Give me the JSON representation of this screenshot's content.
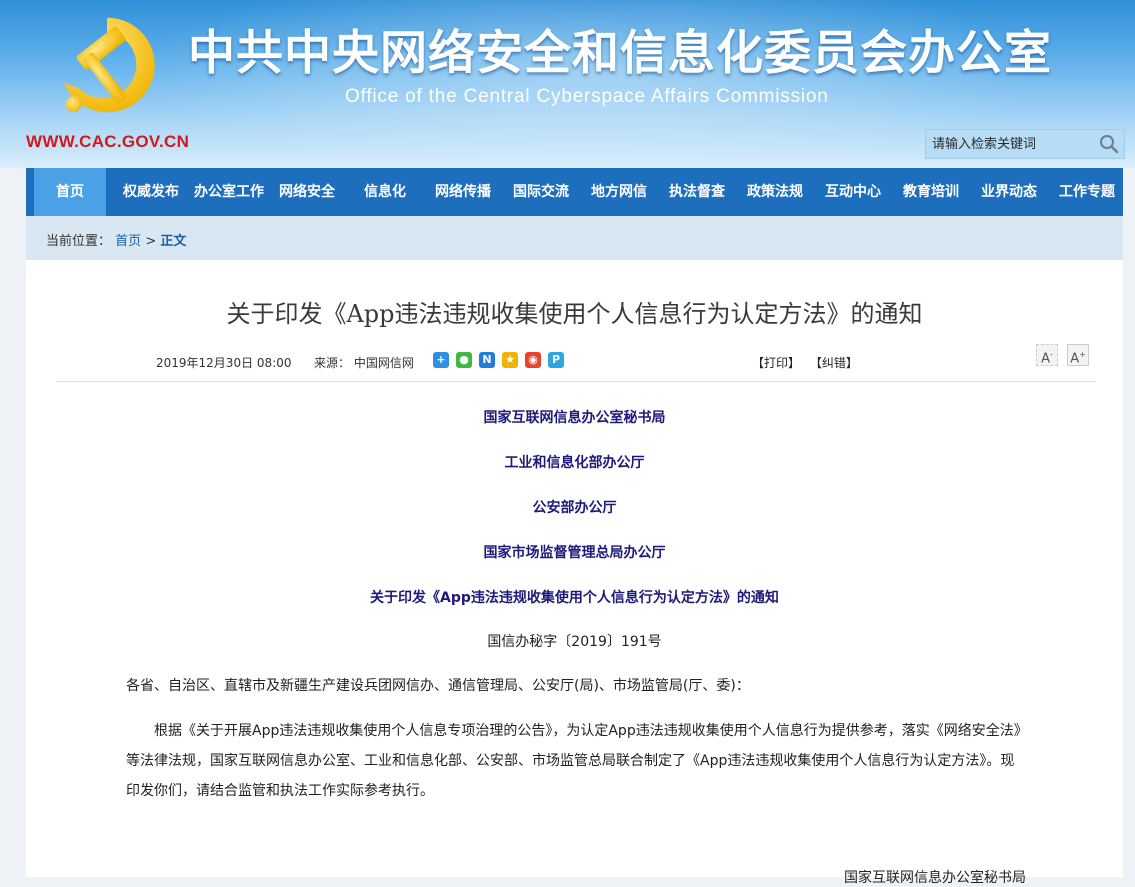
{
  "header": {
    "title": "中共中央网络安全和信息化委员会办公室",
    "subtitle": "Office of the Central Cyberspace Affairs Commission",
    "url": "WWW.CAC.GOV.CN",
    "emblem_icon": "party-emblem-icon",
    "search": {
      "placeholder": "请输入检索关键词",
      "icon": "search-icon"
    }
  },
  "nav": {
    "items": [
      {
        "label": "首页",
        "active": true
      },
      {
        "label": "权威发布"
      },
      {
        "label": "办公室工作"
      },
      {
        "label": "网络安全"
      },
      {
        "label": "信息化"
      },
      {
        "label": "网络传播"
      },
      {
        "label": "国际交流"
      },
      {
        "label": "地方网信"
      },
      {
        "label": "执法督查"
      },
      {
        "label": "政策法规"
      },
      {
        "label": "互动中心"
      },
      {
        "label": "教育培训"
      },
      {
        "label": "业界动态"
      },
      {
        "label": "工作专题"
      }
    ]
  },
  "breadcrumb": {
    "prefix": "当前位置：",
    "home": "首页",
    "sep": ">",
    "current": "正文"
  },
  "article": {
    "title": "关于印发《App违法违规收集使用个人信息行为认定方法》的通知",
    "date": "2019年12月30日 08:00",
    "source": "来源：  中国网信网",
    "share_icons": [
      "share-plus-icon",
      "wechat-icon",
      "news-icon",
      "qzone-icon",
      "weibo-icon",
      "tencent-weibo-icon"
    ],
    "print_label": "【打印】",
    "correct_label": "【纠错】",
    "font_smaller": "A",
    "font_larger": "A",
    "issuers": [
      "国家互联网信息办公室秘书局",
      "工业和信息化部办公厅",
      "公安部办公厅",
      "国家市场监督管理总局办公厅"
    ],
    "notice_title": "关于印发《App违法违规收集使用个人信息行为认定方法》的通知",
    "doc_number": "国信办秘字〔2019〕191号",
    "salutation": "各省、自治区、直辖市及新疆生产建设兵团网信办、通信管理局、公安厅(局)、市场监管局(厅、委)：",
    "body": "根据《关于开展App违法违规收集使用个人信息专项治理的公告》，为认定App违法违规收集使用个人信息行为提供参考，落实《网络安全法》等法律法规，国家互联网信息办公室、工业和信息化部、公安部、市场监管总局联合制定了《App违法违规收集使用个人信息行为认定方法》。现印发你们，请结合监管和执法工作实际参考执行。",
    "signature": "国家互联网信息办公室秘书局"
  },
  "colors": {
    "nav_bg": "#1d6fbd",
    "nav_active": "#4aa1e6",
    "issuer_text": "#1e1a7a",
    "url_red": "#d4171a"
  }
}
